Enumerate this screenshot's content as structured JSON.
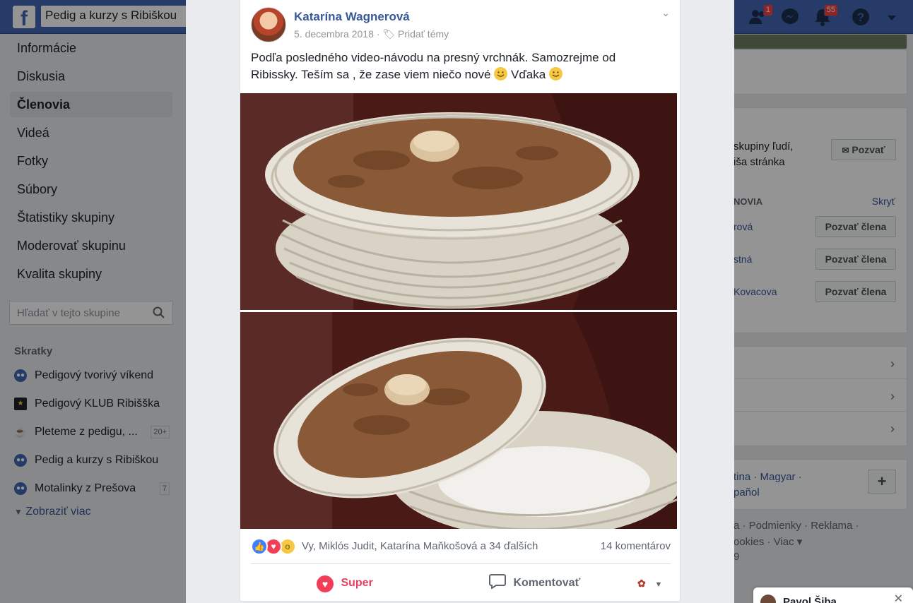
{
  "topbar": {
    "logo": "f",
    "search_value": "Pedig a kurzy s Ribiškou",
    "friend_requests_count": "1",
    "notifications_count": "55"
  },
  "left_nav": {
    "items": [
      {
        "label": "Informácie"
      },
      {
        "label": "Diskusia"
      },
      {
        "label": "Členovia"
      },
      {
        "label": "Videá"
      },
      {
        "label": "Fotky"
      },
      {
        "label": "Súbory"
      },
      {
        "label": "Štatistiky skupiny"
      },
      {
        "label": "Moderovať skupinu"
      },
      {
        "label": "Kvalita skupiny"
      }
    ],
    "search_placeholder": "Hľadať v tejto skupine",
    "shortcuts_title": "Skratky",
    "shortcuts": [
      {
        "label": "Pedigový tvorivý víkend",
        "count": ""
      },
      {
        "label": "Pedigový KLUB Ribišška",
        "count": ""
      },
      {
        "label": "Pleteme z pedigu, ...",
        "count": "20+"
      },
      {
        "label": "Pedig a kurzy s Ribiškou",
        "count": ""
      },
      {
        "label": "Motalinky z Prešova",
        "count": "7"
      }
    ],
    "show_more": "Zobraziť viac"
  },
  "right_col": {
    "invite_text_1": "skupiny ľudí,",
    "invite_text_2": "iša stránka",
    "invite_button": "Pozvať",
    "members_header": "NOVIA",
    "hide_link": "Skryť",
    "members": [
      {
        "name": "rová",
        "button": "Pozvať člena"
      },
      {
        "name": "stná",
        "button": "Pozvať člena"
      },
      {
        "name": "Kovacova",
        "button": "Pozvať člena"
      }
    ],
    "languages_line1": "tina · Magyar ·",
    "languages_line2": "pañol",
    "footer_line1": "a · Podmienky · Reklama ·",
    "footer_line2": "ookies · Viac ▾",
    "footer_line3": "9"
  },
  "post": {
    "author": "Katarína Wagnerová",
    "date": "5. decembra 2018",
    "tag_link": "Pridať témy",
    "text_line1": "Podľa posledného video-návodu na presný vrchnák. Samozrejme od",
    "text_line2_a": "Ribissky. Teším sa , že zase viem niečo nové",
    "text_line2_b": "Vďaka",
    "reactions_names": "Vy, Miklós Judit, Katarína Maňkošová a 34 ďalších",
    "comments_count": "14 komentárov",
    "action_super": "Super",
    "action_comment": "Komentovať"
  },
  "chat": {
    "name": "Pavol Šiba"
  },
  "colors": {
    "brand_blue": "#4267b2",
    "link_blue": "#385898",
    "super_red": "#e4405f"
  }
}
